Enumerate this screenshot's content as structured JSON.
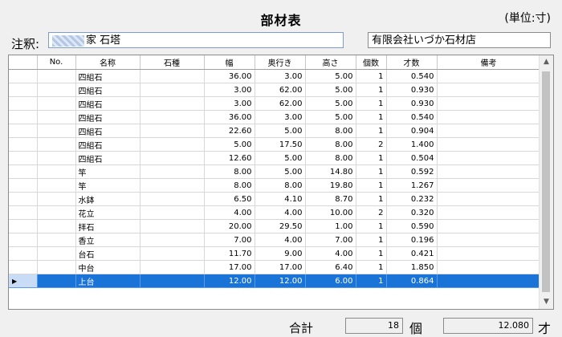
{
  "header": {
    "title": "部材表",
    "unit": "(単位:寸)"
  },
  "remark": {
    "label": "注釈:",
    "value": "家 石塔"
  },
  "company": {
    "value": "有限会社いづか石材店"
  },
  "table": {
    "columns": [
      "No.",
      "名称",
      "石種",
      "幅",
      "奥行き",
      "高さ",
      "個数",
      "才数",
      "備考"
    ],
    "rows": [
      {
        "no": "",
        "name": "四組石",
        "stone": "",
        "width": "36.00",
        "depth": "3.00",
        "height": "5.00",
        "count": "1",
        "sai": "0.540",
        "note": ""
      },
      {
        "no": "",
        "name": "四組石",
        "stone": "",
        "width": "3.00",
        "depth": "62.00",
        "height": "5.00",
        "count": "1",
        "sai": "0.930",
        "note": ""
      },
      {
        "no": "",
        "name": "四組石",
        "stone": "",
        "width": "3.00",
        "depth": "62.00",
        "height": "5.00",
        "count": "1",
        "sai": "0.930",
        "note": ""
      },
      {
        "no": "",
        "name": "四組石",
        "stone": "",
        "width": "36.00",
        "depth": "3.00",
        "height": "5.00",
        "count": "1",
        "sai": "0.540",
        "note": ""
      },
      {
        "no": "",
        "name": "四組石",
        "stone": "",
        "width": "22.60",
        "depth": "5.00",
        "height": "8.00",
        "count": "1",
        "sai": "0.904",
        "note": ""
      },
      {
        "no": "",
        "name": "四組石",
        "stone": "",
        "width": "5.00",
        "depth": "17.50",
        "height": "8.00",
        "count": "2",
        "sai": "1.400",
        "note": ""
      },
      {
        "no": "",
        "name": "四組石",
        "stone": "",
        "width": "12.60",
        "depth": "5.00",
        "height": "8.00",
        "count": "1",
        "sai": "0.504",
        "note": ""
      },
      {
        "no": "",
        "name": "竿",
        "stone": "",
        "width": "8.00",
        "depth": "5.00",
        "height": "14.80",
        "count": "1",
        "sai": "0.592",
        "note": ""
      },
      {
        "no": "",
        "name": "竿",
        "stone": "",
        "width": "8.00",
        "depth": "8.00",
        "height": "19.80",
        "count": "1",
        "sai": "1.267",
        "note": ""
      },
      {
        "no": "",
        "name": "水鉢",
        "stone": "",
        "width": "6.50",
        "depth": "4.10",
        "height": "8.70",
        "count": "1",
        "sai": "0.232",
        "note": ""
      },
      {
        "no": "",
        "name": "花立",
        "stone": "",
        "width": "4.00",
        "depth": "4.00",
        "height": "10.00",
        "count": "2",
        "sai": "0.320",
        "note": ""
      },
      {
        "no": "",
        "name": "拝石",
        "stone": "",
        "width": "20.00",
        "depth": "29.50",
        "height": "1.00",
        "count": "1",
        "sai": "0.590",
        "note": ""
      },
      {
        "no": "",
        "name": "香立",
        "stone": "",
        "width": "7.00",
        "depth": "4.00",
        "height": "7.00",
        "count": "1",
        "sai": "0.196",
        "note": ""
      },
      {
        "no": "",
        "name": "台石",
        "stone": "",
        "width": "11.70",
        "depth": "9.00",
        "height": "4.00",
        "count": "1",
        "sai": "0.421",
        "note": ""
      },
      {
        "no": "",
        "name": "中台",
        "stone": "",
        "width": "17.00",
        "depth": "17.00",
        "height": "6.40",
        "count": "1",
        "sai": "1.850",
        "note": ""
      },
      {
        "no": "",
        "name": "上台",
        "stone": "",
        "width": "12.00",
        "depth": "12.00",
        "height": "6.00",
        "count": "1",
        "sai": "0.864",
        "note": "",
        "selected": true
      }
    ]
  },
  "totals": {
    "label": "合計",
    "count": "18",
    "count_unit": "個",
    "sai": "12.080",
    "sai_unit": "才"
  },
  "icons": {
    "row_pointer": "triangle-right-icon",
    "scroll_up": "chevron-up-icon",
    "scroll_down": "chevron-down-icon"
  },
  "colors": {
    "selected_row": "#1a73d6",
    "input_border": "#7a9cd3"
  }
}
